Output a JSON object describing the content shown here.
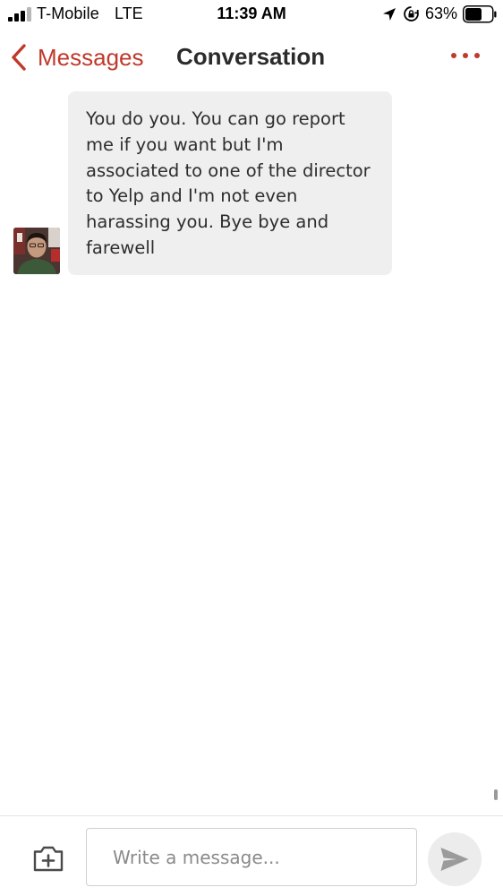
{
  "status_bar": {
    "carrier": "T-Mobile",
    "network": "LTE",
    "time": "11:39 AM",
    "battery_percent_label": "63%",
    "battery_level": 0.63,
    "signal_bars_filled": 3,
    "signal_bars_total": 4,
    "icons": [
      "location-arrow-icon",
      "rotation-lock-icon",
      "battery-icon"
    ]
  },
  "nav": {
    "back_label": "Messages",
    "title": "Conversation",
    "more_icon": "ellipsis-icon"
  },
  "conversation": {
    "messages": [
      {
        "sender": "other",
        "text": "You do you. You can go report me if you want but I'm associated to one of the director to Yelp and I'm not even harassing you. Bye bye and farewell"
      }
    ]
  },
  "composer": {
    "placeholder": "Write a message...",
    "value": "",
    "camera_icon": "camera-plus-icon",
    "send_icon": "send-icon"
  },
  "colors": {
    "accent": "#c0392b",
    "bubble_background": "#efefef",
    "send_button_background": "#ececec"
  }
}
